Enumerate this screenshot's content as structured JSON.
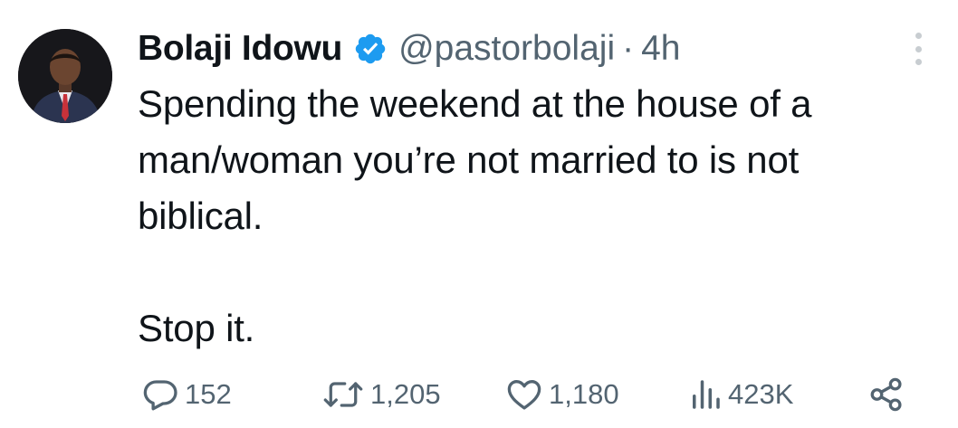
{
  "author": {
    "name": "Bolaji Idowu",
    "handle": "@pastorbolaji",
    "separator": "·",
    "time": "4h",
    "verified_color": "#1d9bf0"
  },
  "tweet": {
    "lines": [
      "Spending the weekend at the house of a",
      "man/woman you’re not married to is not",
      "biblical.",
      "",
      "Stop it."
    ]
  },
  "actions": {
    "replies": "152",
    "retweets": "1,205",
    "likes": "1,180",
    "views": "423K"
  },
  "icons": {
    "reply": "speech-bubble-icon",
    "retweet": "retweet-arrows-icon",
    "like": "heart-icon",
    "views": "bar-chart-icon",
    "share": "share-nodes-icon",
    "more": "vertical-dots-icon"
  },
  "colors": {
    "text": "#0f1419",
    "muted": "#536471",
    "verified": "#1d9bf0"
  }
}
